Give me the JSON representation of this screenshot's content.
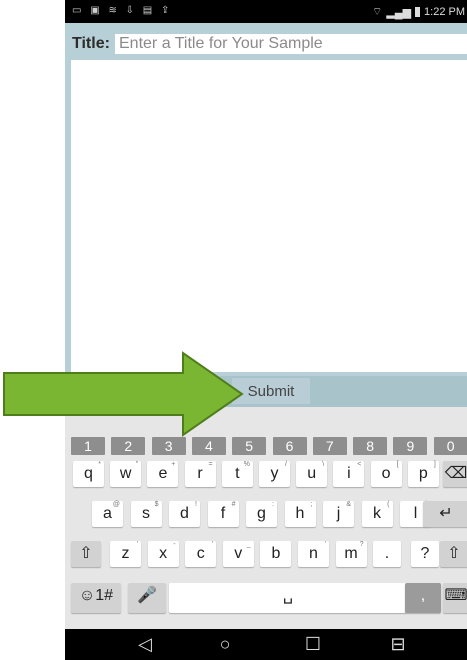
{
  "status_bar": {
    "time": "1:22 PM",
    "notification_icons": [
      "voicemail-icon",
      "gallery-icon",
      "wifi-icon",
      "download-icon",
      "message-icon",
      "upload-icon"
    ]
  },
  "form": {
    "title_label": "Title:",
    "title_placeholder": "Enter a Title for Your Sample",
    "title_value": "",
    "body_value": "",
    "submit_label": "Submit"
  },
  "keyboard": {
    "number_row": [
      "1",
      "2",
      "3",
      "4",
      "5",
      "6",
      "7",
      "8",
      "9",
      "0"
    ],
    "row1": [
      {
        "k": "q",
        "alt": "*"
      },
      {
        "k": "w",
        "alt": "\""
      },
      {
        "k": "e",
        "alt": "+"
      },
      {
        "k": "r",
        "alt": "="
      },
      {
        "k": "t",
        "alt": "%"
      },
      {
        "k": "y",
        "alt": "/"
      },
      {
        "k": "u",
        "alt": "\\"
      },
      {
        "k": "i",
        "alt": "<"
      },
      {
        "k": "o",
        "alt": "["
      },
      {
        "k": "p",
        "alt": "]"
      }
    ],
    "row2": [
      {
        "k": "a",
        "alt": "@"
      },
      {
        "k": "s",
        "alt": "$"
      },
      {
        "k": "d",
        "alt": "!"
      },
      {
        "k": "f",
        "alt": "#"
      },
      {
        "k": "g",
        "alt": ":"
      },
      {
        "k": "h",
        "alt": ";"
      },
      {
        "k": "j",
        "alt": "&"
      },
      {
        "k": "k",
        "alt": "("
      },
      {
        "k": "l",
        "alt": ")"
      }
    ],
    "row3": [
      {
        "k": "z",
        "alt": "'"
      },
      {
        "k": "x",
        "alt": "-"
      },
      {
        "k": "c",
        "alt": "'"
      },
      {
        "k": "v",
        "alt": "_"
      },
      {
        "k": "b",
        "alt": ""
      },
      {
        "k": "n",
        "alt": "'"
      },
      {
        "k": "m",
        "alt": "?"
      }
    ],
    "period": ".",
    "question": "?",
    "comma": ",",
    "symbols_label": "☺1#"
  },
  "colors": {
    "accent_arrow": "#7ab631",
    "app_background": "#b7cfd6"
  }
}
